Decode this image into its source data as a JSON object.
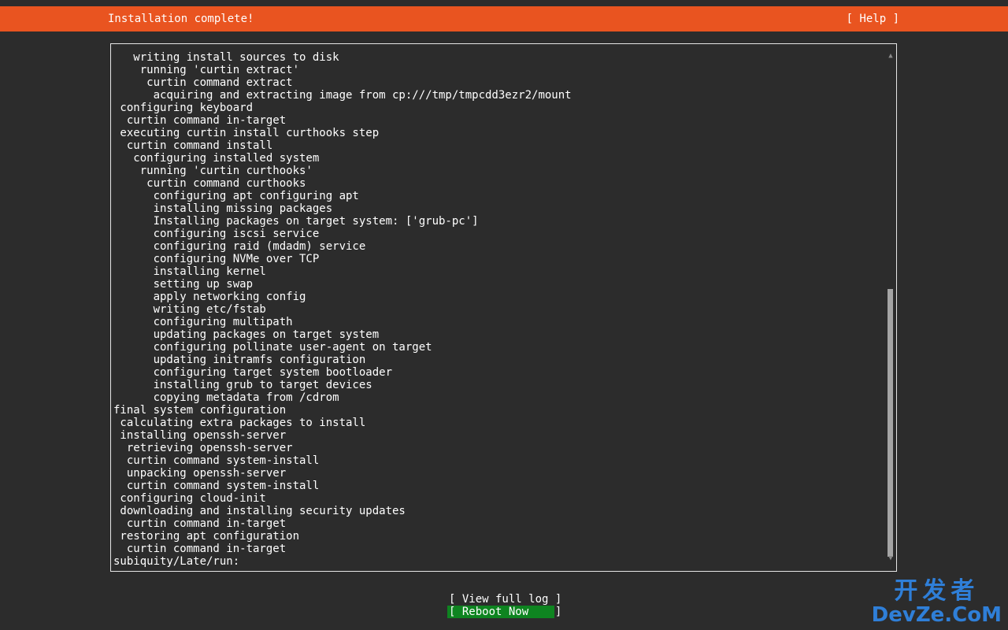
{
  "header": {
    "title": "Installation complete!",
    "help_label": "[ Help ]",
    "background": "#e95420"
  },
  "log": {
    "lines": [
      "   writing install sources to disk",
      "    running 'curtin extract'",
      "     curtin command extract",
      "      acquiring and extracting image from cp:///tmp/tmpcdd3ezr2/mount",
      " configuring keyboard",
      "  curtin command in-target",
      " executing curtin install curthooks step",
      "  curtin command install",
      "   configuring installed system",
      "    running 'curtin curthooks'",
      "     curtin command curthooks",
      "      configuring apt configuring apt",
      "      installing missing packages",
      "      Installing packages on target system: ['grub-pc']",
      "      configuring iscsi service",
      "      configuring raid (mdadm) service",
      "      configuring NVMe over TCP",
      "      installing kernel",
      "      setting up swap",
      "      apply networking config",
      "      writing etc/fstab",
      "      configuring multipath",
      "      updating packages on target system",
      "      configuring pollinate user-agent on target",
      "      updating initramfs configuration",
      "      configuring target system bootloader",
      "      installing grub to target devices",
      "      copying metadata from /cdrom",
      "final system configuration",
      " calculating extra packages to install",
      " installing openssh-server",
      "  retrieving openssh-server",
      "  curtin command system-install",
      "  unpacking openssh-server",
      "  curtin command system-install",
      " configuring cloud-init",
      " downloading and installing security updates",
      "  curtin command in-target",
      " restoring apt configuration",
      "  curtin command in-target",
      "subiquity/Late/run:"
    ]
  },
  "scrollbar": {
    "up_icon": "▲",
    "down_icon": "▼",
    "position_fraction": 0.47
  },
  "buttons": {
    "view_log_label": "[ View full log ]",
    "reboot_label": "[ Reboot Now    ]",
    "reboot_color": "#0e8420"
  },
  "watermark": {
    "top": "开发者",
    "bottom": "DevZe.CoM"
  }
}
